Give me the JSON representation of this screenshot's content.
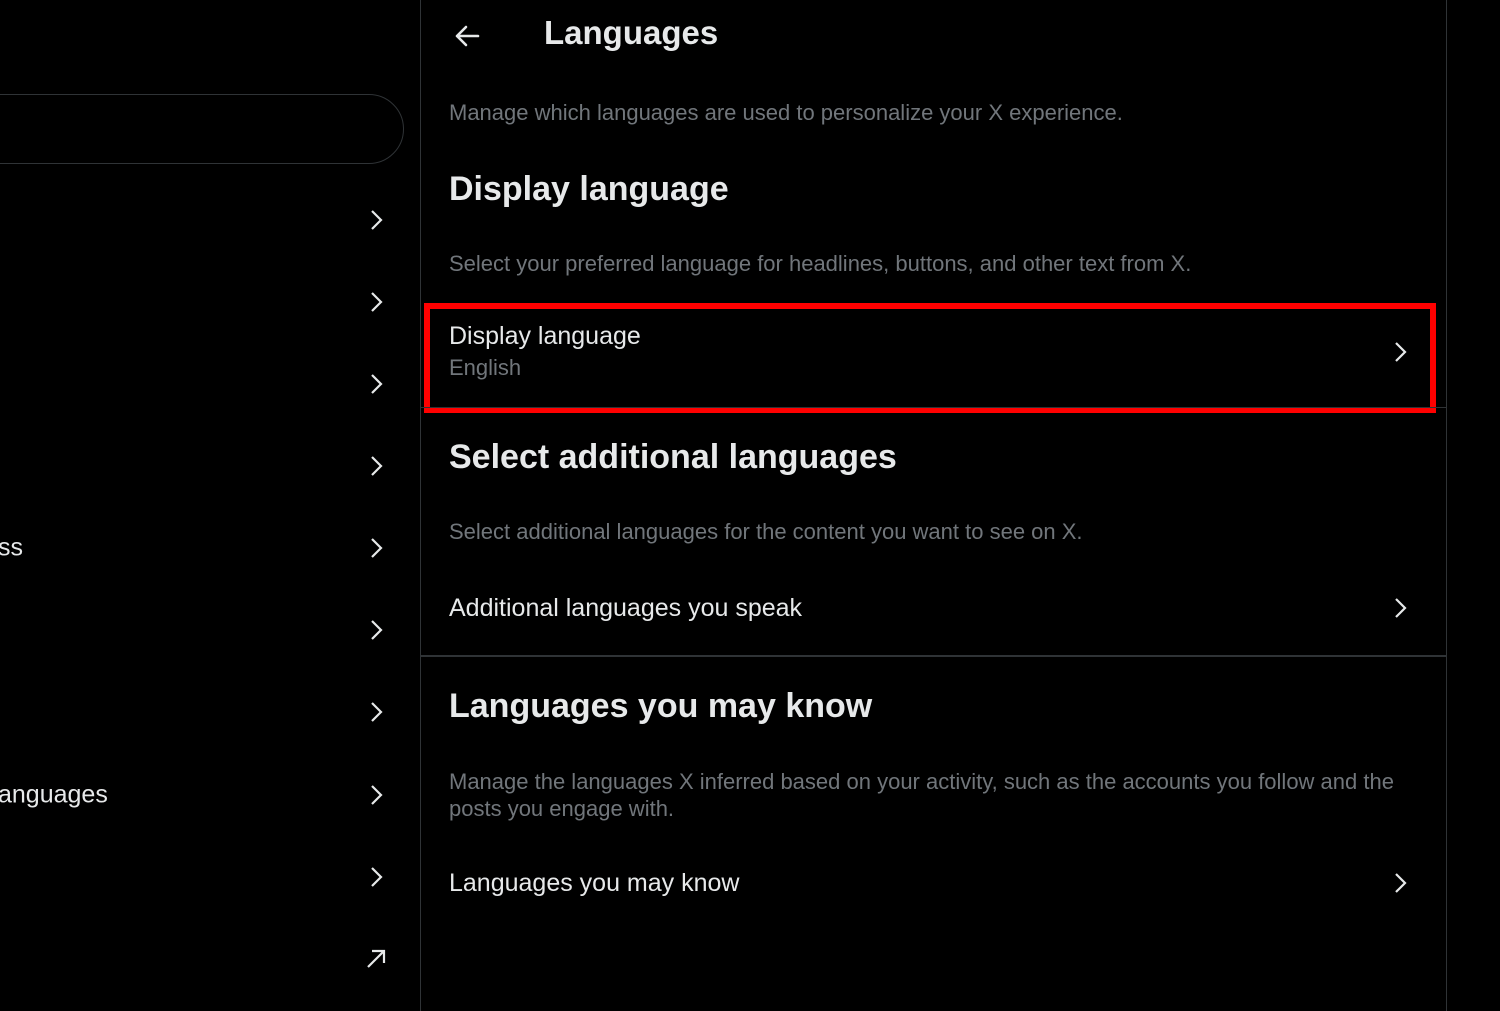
{
  "left_nav": {
    "items": [
      {
        "label": ""
      },
      {
        "label": ""
      },
      {
        "label": ""
      },
      {
        "label": ""
      },
      {
        "label": "ss"
      },
      {
        "label": ""
      },
      {
        "label": ""
      },
      {
        "label": "anguages"
      },
      {
        "label": ""
      }
    ]
  },
  "header": {
    "title": "Languages"
  },
  "intro": "Manage which languages are used to personalize your X experience.",
  "display_section": {
    "title": "Display language",
    "description": "Select your preferred language for headlines, buttons, and other text from X.",
    "row_title": "Display language",
    "row_value": "English"
  },
  "additional_section": {
    "title": "Select additional languages",
    "description": "Select additional languages for the content you want to see on X.",
    "row_title": "Additional languages you speak"
  },
  "known_section": {
    "title": "Languages you may know",
    "description": "Manage the languages X inferred based on your activity, such as the accounts you follow and the posts you engage with.",
    "row_title": "Languages you may know"
  },
  "colors": {
    "background": "#000000",
    "text_primary": "#e7e9ea",
    "text_secondary": "#71767b",
    "border": "#2f3336",
    "highlight": "#ff0000"
  }
}
